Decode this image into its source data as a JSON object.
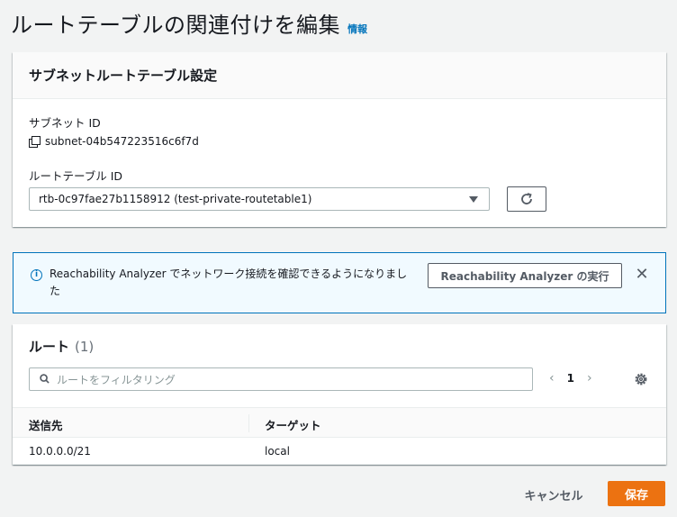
{
  "page": {
    "title": "ルートテーブルの関連付けを編集",
    "info_link": "情報"
  },
  "settings": {
    "header": "サブネットルートテーブル設定",
    "subnet_label": "サブネット ID",
    "subnet_value": "subnet-04b547223516c6f7d",
    "route_table_label": "ルートテーブル ID",
    "route_table_selected": "rtb-0c97fae27b1158912 (test-private-routetable1)"
  },
  "alert": {
    "message": "Reachability Analyzer でネットワーク接続を確認できるようになりました",
    "action_label": "Reachability Analyzer の実行",
    "close_label": "✕"
  },
  "routes": {
    "title": "ルート",
    "count": "(1)",
    "filter_placeholder": "ルートをフィルタリング",
    "pagination": {
      "prev": "‹",
      "current": "1",
      "next": "›"
    },
    "columns": [
      "送信先",
      "ターゲット"
    ],
    "rows": [
      {
        "destination": "10.0.0.0/21",
        "target": "local"
      }
    ]
  },
  "footer": {
    "cancel_label": "キャンセル",
    "save_label": "保存"
  },
  "colors": {
    "accent_orange": "#ec7211",
    "link_blue": "#0073bb",
    "alert_bg": "#f1faff"
  },
  "icons": [
    "copy-icon",
    "chevron-down-icon",
    "refresh-icon",
    "info-icon",
    "close-icon",
    "search-icon",
    "gear-icon"
  ]
}
